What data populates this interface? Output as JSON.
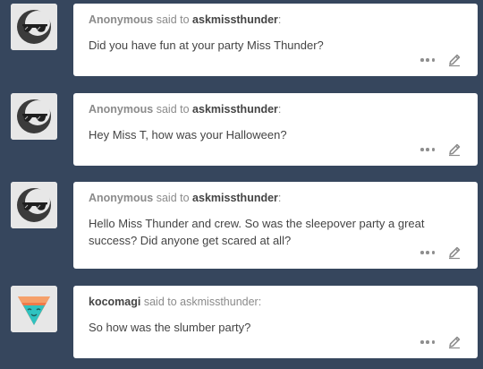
{
  "asks": [
    {
      "asker": "Anonymous",
      "said_to": "said to",
      "recipient": "askmissthunder",
      "colon": ":",
      "question": "Did you have fun at your party Miss Thunder?",
      "avatar_icon": "anonymous-sunglasses-icon",
      "more_icon": "more-dots-icon",
      "edit_icon": "pencil-icon"
    },
    {
      "asker": "Anonymous",
      "said_to": "said to",
      "recipient": "askmissthunder",
      "colon": ":",
      "question": "Hey Miss T, how was your Halloween?",
      "avatar_icon": "anonymous-sunglasses-icon",
      "more_icon": "more-dots-icon",
      "edit_icon": "pencil-icon"
    },
    {
      "asker": "Anonymous",
      "said_to": "said to",
      "recipient": "askmissthunder",
      "colon": ":",
      "question": "Hello Miss Thunder and crew. So was the sleepover party a great success? Did anyone get scared at all?",
      "avatar_icon": "anonymous-sunglasses-icon",
      "more_icon": "more-dots-icon",
      "edit_icon": "pencil-icon"
    },
    {
      "asker": "kocomagi",
      "said_to": "said to",
      "recipient": "askmissthunder",
      "colon": ":",
      "question": "So how was the slumber party?",
      "avatar_icon": "cone-triangle-avatar-icon",
      "more_icon": "more-dots-icon",
      "edit_icon": "pencil-icon"
    }
  ],
  "colors": {
    "background": "#36465d",
    "card": "#ffffff",
    "muted_text": "#8b8b8b",
    "body_text": "#444444",
    "avatar_dark": "#3b3b3b",
    "avatar_bg": "#e7e7e7",
    "cone_orange": "#f07a4a",
    "cone_teal": "#2fc2c0"
  }
}
